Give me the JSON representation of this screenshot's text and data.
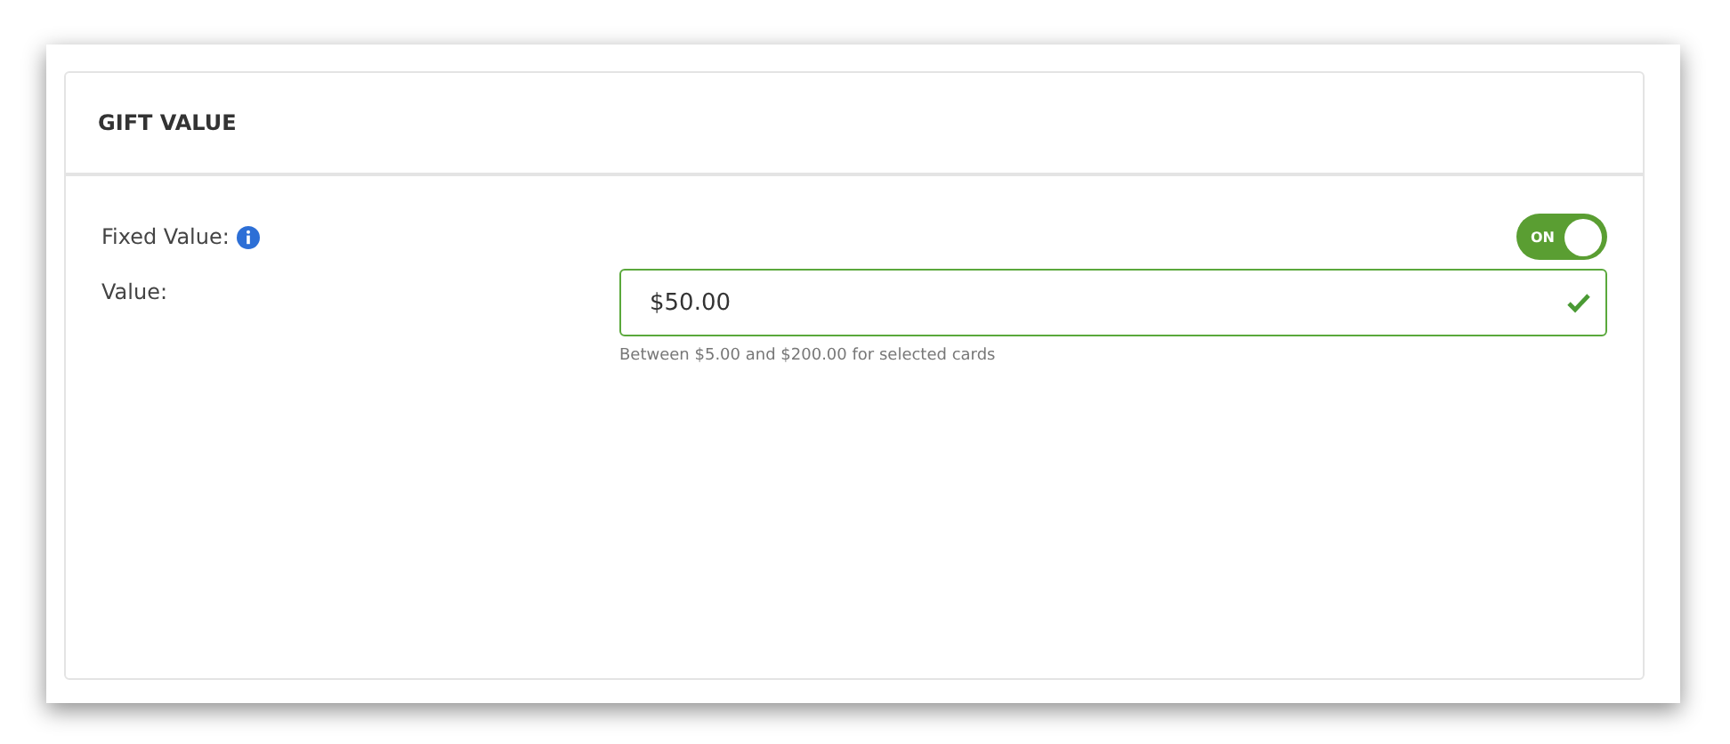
{
  "card": {
    "title": "GIFT VALUE"
  },
  "fixed_value": {
    "label": "Fixed Value:",
    "toggle": {
      "on": true,
      "label": "ON"
    }
  },
  "value": {
    "label": "Value:",
    "value": "$50.00",
    "valid": true,
    "hint": "Between $5.00 and $200.00 for selected cards"
  }
}
